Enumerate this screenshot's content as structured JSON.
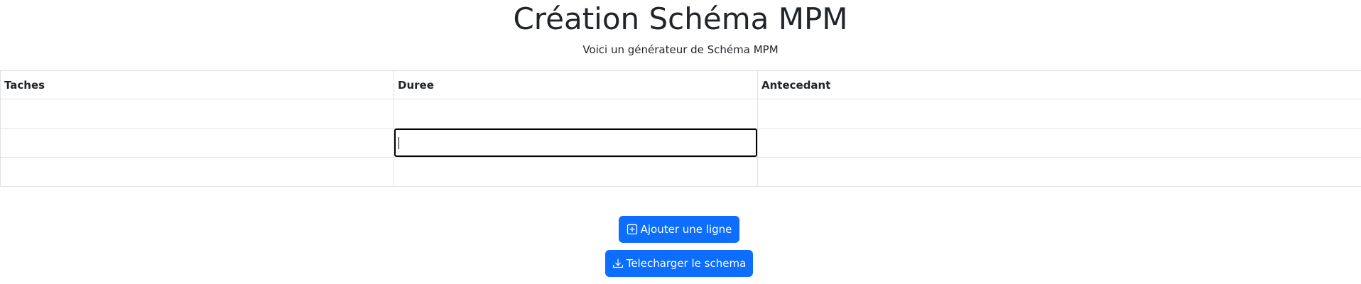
{
  "header": {
    "title": "Création Schéma MPM",
    "subtitle": "Voici un générateur de Schéma MPM"
  },
  "table": {
    "columns": [
      "Taches",
      "Duree",
      "Antecedant"
    ],
    "rows": [
      [
        "",
        "",
        ""
      ],
      [
        "",
        "",
        ""
      ],
      [
        "",
        "",
        ""
      ]
    ],
    "focused_cell": {
      "row": 1,
      "column": "Duree"
    }
  },
  "actions": {
    "add_row_label": "Ajouter une ligne",
    "add_row_icon": "plus-square-icon",
    "download_label": "Telecharger le schema",
    "download_icon": "download-icon"
  },
  "colors": {
    "primary": "#0d6efd",
    "text": "#212529",
    "border": "#dee2e6"
  }
}
